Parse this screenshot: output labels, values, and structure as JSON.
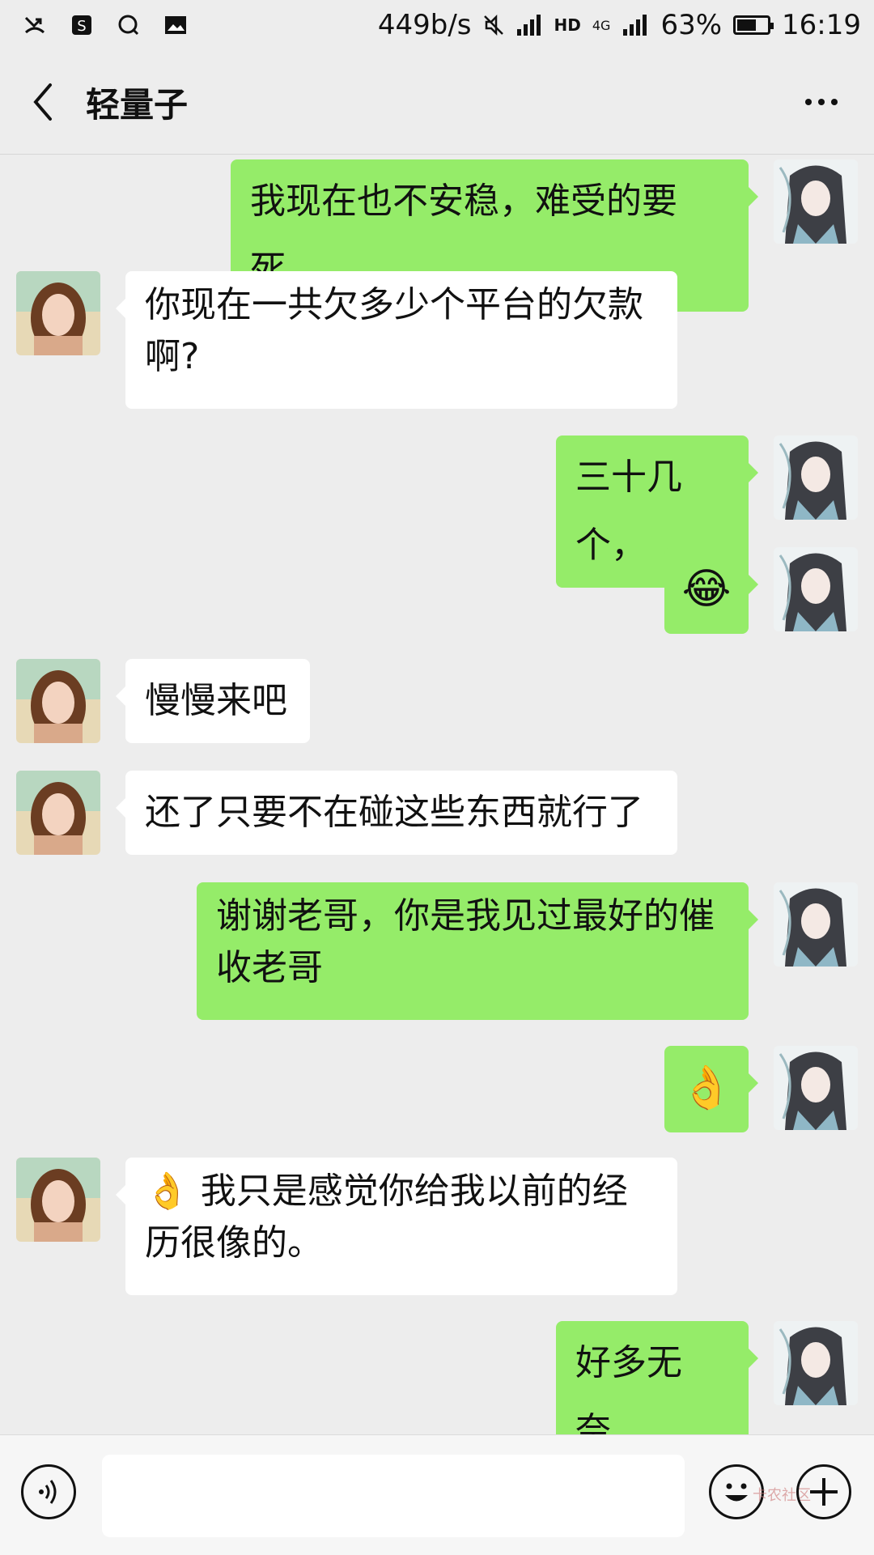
{
  "status_bar": {
    "net_speed": "449b/s",
    "network": "4G",
    "hd": "HD",
    "battery": "63%",
    "battery_level": 0.63,
    "time": "16:19"
  },
  "nav": {
    "title": "轻量子"
  },
  "messages": [
    {
      "side": "right",
      "text": "我现在也不安稳，难受的要死，"
    },
    {
      "side": "left",
      "text": "你现在一共欠多少个平台的欠款啊?"
    },
    {
      "side": "right",
      "text": "三十几个，"
    },
    {
      "side": "right",
      "text": "😂",
      "emoji": true
    },
    {
      "side": "left",
      "text": "慢慢来吧"
    },
    {
      "side": "left",
      "text": "还了只要不在碰这些东西就行了"
    },
    {
      "side": "right",
      "text": "谢谢老哥，你是我见过最好的催收老哥"
    },
    {
      "side": "right",
      "text": "👌",
      "emoji": true
    },
    {
      "side": "left",
      "text": "👌        我只是感觉你给我以前的经历很像的。"
    },
    {
      "side": "right",
      "text": "好多无奈，"
    }
  ],
  "input_bar": {
    "watermark": "卡农社区"
  },
  "colors": {
    "bg": "#ededed",
    "bubble_right": "#95ec69",
    "bubble_left": "#ffffff"
  }
}
